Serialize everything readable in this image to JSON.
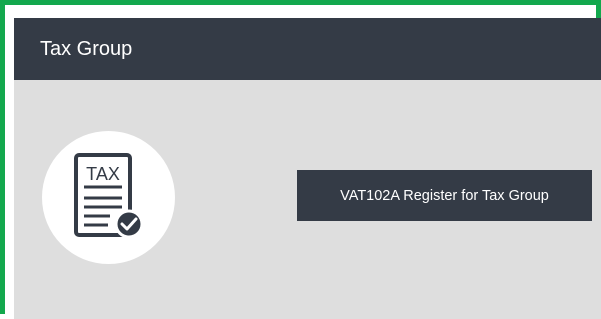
{
  "panel": {
    "title": "Tax Group",
    "icon": {
      "name": "tax-document-check-icon",
      "label": "TAX"
    },
    "action_button_label": "VAT102A Register for Tax Group"
  },
  "colors": {
    "frame_border": "#13a84d",
    "header_bg": "#343b46",
    "body_bg": "#dedede",
    "button_bg": "#343b46",
    "text_light": "#ffffff"
  }
}
